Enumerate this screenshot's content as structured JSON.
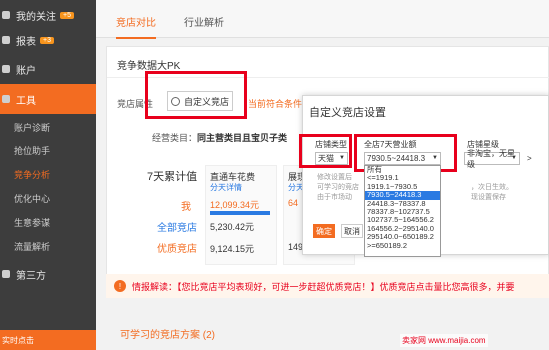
{
  "sidebar": {
    "items": [
      {
        "label": "我的关注",
        "badge": "+5"
      },
      {
        "label": "报表",
        "badge": "+3"
      },
      {
        "label": "账户"
      },
      {
        "label": "工具"
      }
    ],
    "subitems": [
      "账户诊断",
      "抢位助手",
      "竞争分析",
      "优化中心",
      "生意参谋",
      "流量解析"
    ],
    "third": "第三方",
    "bottom": "实时点击"
  },
  "tabs": [
    "竞店对比",
    "行业解析"
  ],
  "card": {
    "title": "竞争数据大PK",
    "attr_label": "竞店属性",
    "custom_btn": "自定义竞店",
    "cond_link": "当前符合条件的",
    "cat_prefix": "经营类目：",
    "cat_value": "同主营类目且宝贝子类"
  },
  "metrics": {
    "label": "7天累计值",
    "me": "我",
    "all": "全部竞店",
    "good": "优质竞店"
  },
  "columns": [
    {
      "title": "直通车花费",
      "sub": "分天详情",
      "me": "12,099.34元",
      "all": "5,230.42元",
      "good": "9,124.15元"
    },
    {
      "title": "展现",
      "sub": "分天",
      "me": "64",
      "all": "",
      "good": "149"
    }
  ],
  "info": "情报解读：【您比竞店平均表现好，可进一步赶超优质竞店！】优质竞店点击量比您高很多，并要",
  "learn": "可学习的竞店方案 (2)",
  "modal": {
    "title": "自定义竞店设置",
    "shop_type_label": "店铺类型",
    "shop_type_value": "天猫",
    "sales_label": "全店7天营业额",
    "sales_value": "7930.5~24418.3",
    "level_label": "店铺星级",
    "level_value": "非淘宝，无星级",
    "hint1": "修改设置后",
    "hint2": "可学习的竞店",
    "hint3": "由于市场动",
    "hint4": "，次日生效。",
    "hint5": "现设置保存",
    "ok": "确定",
    "cancel": "取消",
    "options": [
      "所有",
      "<=1919.1",
      "1919.1~7930.5",
      "7930.5~24418.3",
      "24418.3~78337.8",
      "78337.8~102737.5",
      "102737.5~164556.2",
      "164556.2~295140.0",
      "295140.0~650189.2",
      ">=650189.2"
    ]
  },
  "watermark": "卖家网 www.maijia.com"
}
